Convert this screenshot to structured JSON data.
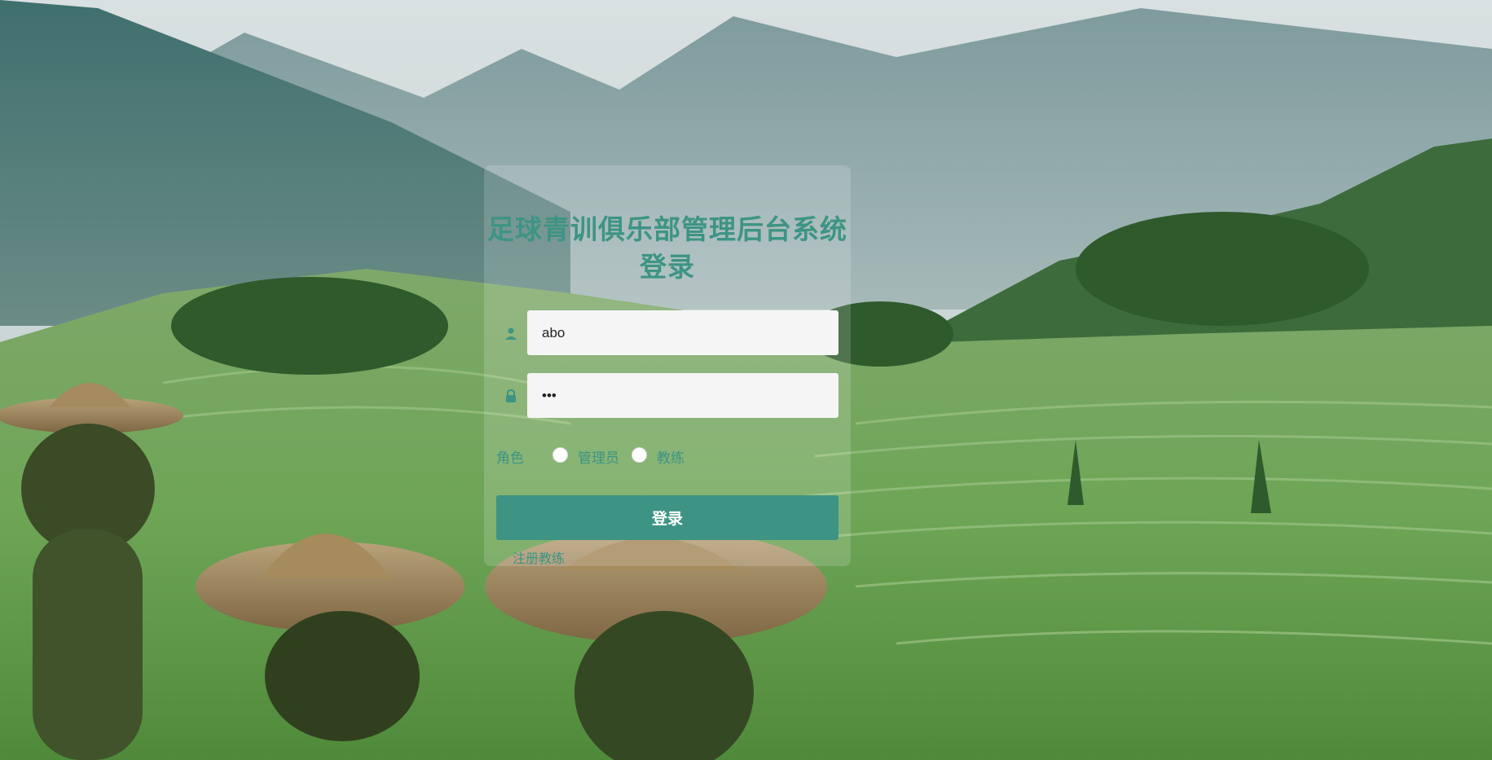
{
  "login": {
    "title": "足球青训俱乐部管理后台系统登录",
    "username_value": "abo",
    "password_value": "•••",
    "role_label": "角色",
    "roles": [
      {
        "label": "管理员",
        "selected": false
      },
      {
        "label": "教练",
        "selected": false
      }
    ],
    "login_button": "登录",
    "register_link": "注册教练"
  },
  "colors": {
    "accent": "#3d9484",
    "field_bg": "#f5f5f5",
    "panel_bg": "rgba(255,255,255,0.16)"
  },
  "icons": {
    "username": "user-icon",
    "password": "lock-icon"
  }
}
